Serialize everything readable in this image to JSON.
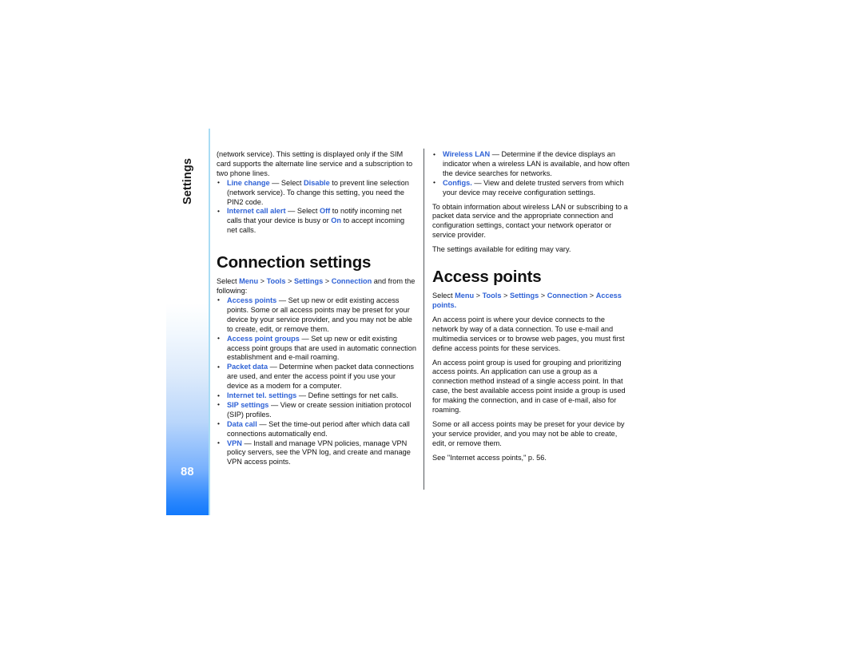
{
  "page": {
    "number": "88",
    "chapter_label": "Settings",
    "accent_blue": "#2f62d6",
    "tab_blue": "#1279fc",
    "rule_blue": "#a9dcf4"
  },
  "left_column": {
    "intro_paragraph": "(network service). This setting is displayed only if the SIM card supports the alternate line service and a subscription to two phone lines.",
    "bullets": [
      {
        "term": "Line change",
        "dash": "—",
        "text_before": "Select",
        "value": "Disable",
        "text_after": "to prevent line selection (network service). To change this setting, you need the PIN2 code."
      },
      {
        "term": "Internet call alert",
        "dash": "—",
        "text_before": "Select",
        "value": "Off",
        "text_mid": "to notify incoming net calls that your device is busy or",
        "value2": "On",
        "text_after": "to accept incoming net calls."
      }
    ],
    "heading": "Connection settings",
    "select_line": {
      "prefix": "Select",
      "path": [
        "Menu",
        "Tools",
        "Settings",
        "Connection"
      ],
      "separator": ">",
      "suffix": "and from the following:"
    },
    "setting_bullets": [
      {
        "term": "Access points",
        "dash": "—",
        "text": "Set up new or edit existing access points. Some or all access points may be preset for your device by your service provider, and you may not be able to create, edit, or remove them."
      },
      {
        "term": "Access point groups",
        "dash": "—",
        "text": "Set up new or edit existing access point groups that are used in automatic connection establishment and e-mail roaming."
      },
      {
        "term": "Packet data",
        "dash": "—",
        "text": "Determine when packet data connections are used, and enter the access point if you use your device as a modem for a computer."
      },
      {
        "term": "Internet tel. settings",
        "dash": "—",
        "text": "Define settings for net calls."
      },
      {
        "term": "SIP settings",
        "dash": "—",
        "text": "View or create session initiation protocol (SIP) profiles."
      },
      {
        "term": "Data call",
        "dash": "—",
        "text": "Set the time-out period after which data call connections automatically end."
      },
      {
        "term": "VPN",
        "dash": "—",
        "text": "Install and manage VPN policies, manage VPN policy servers, see the VPN log, and create and manage VPN access points."
      }
    ]
  },
  "right_column": {
    "bullets": [
      {
        "term": "Wireless LAN",
        "dash": "—",
        "text": "Determine if the device displays an indicator when a wireless LAN is available, and how often the device searches for networks."
      },
      {
        "term": "Configs.",
        "dash": "—",
        "text": "View and delete trusted servers from which your device may receive configuration settings."
      }
    ],
    "paragraph_1": "To obtain information about wireless LAN or subscribing to a packet data service and the appropriate connection and configuration settings, contact your network operator or service provider.",
    "paragraph_2": "The settings available for editing may vary.",
    "heading": "Access points",
    "select_line": {
      "prefix": "Select",
      "path": [
        "Menu",
        "Tools",
        "Settings",
        "Connection",
        "Access points"
      ],
      "separator": ">",
      "terminator": "."
    },
    "paragraph_3": "An access point is where your device connects to the network by way of a data connection. To use e-mail and multimedia services or to browse web pages, you must first define access points for these services.",
    "paragraph_4": "An access point group is used for grouping and prioritizing access points. An application can use a group as a connection method instead of a single access point. In that case, the best available access point inside a group is used for making the connection, and in case of e-mail, also for roaming.",
    "paragraph_5": "Some or all access points may be preset for your device by your service provider, and you may not be able to create, edit, or remove them.",
    "cross_reference": "See \"Internet access points,\" p. 56."
  }
}
